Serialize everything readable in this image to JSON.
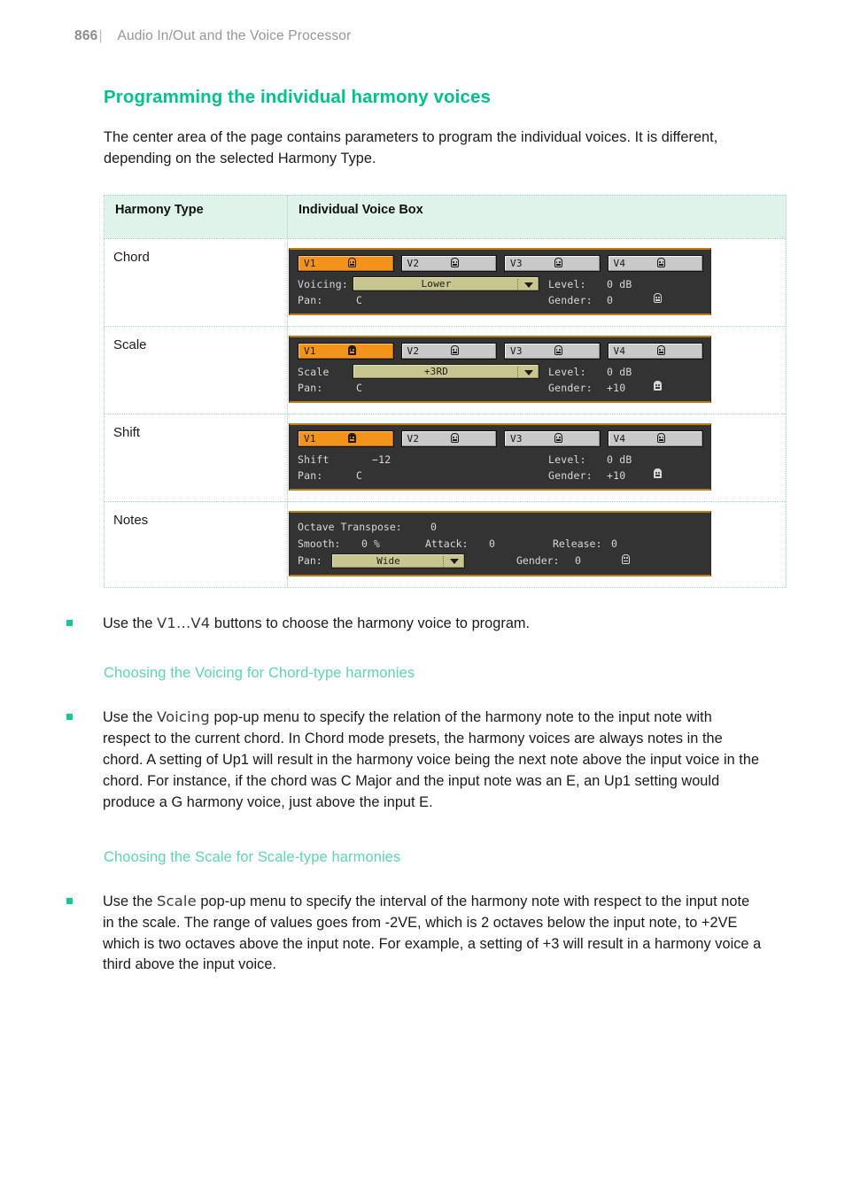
{
  "header": {
    "page_number": "866",
    "separator": "|",
    "chapter": "Audio In/Out and the Voice Processor"
  },
  "section": {
    "title": "Programming the individual harmony voices",
    "intro": "The center area of the page contains parameters to program the individual voices. It is different, depending on the selected Harmony Type."
  },
  "table": {
    "headers": {
      "type": "Harmony Type",
      "box": "Individual Voice Box"
    },
    "rows": [
      {
        "type": "Chord",
        "voice_buttons": [
          {
            "label": "V1",
            "icon": "head-icon",
            "active": true
          },
          {
            "label": "V2",
            "icon": "head-icon",
            "active": false
          },
          {
            "label": "V3",
            "icon": "head-icon",
            "active": false
          },
          {
            "label": "V4",
            "icon": "head-icon",
            "active": false
          }
        ],
        "param_label": "Voicing:",
        "param_control": "dropdown",
        "param_value": "Lower",
        "level_label": "Level:",
        "level_value": "0 dB",
        "pan_label": "Pan:",
        "pan_value": "C",
        "gender_label": "Gender:",
        "gender_value": "0",
        "gender_icon": "head-icon"
      },
      {
        "type": "Scale",
        "voice_buttons": [
          {
            "label": "V1",
            "icon": "head-filled-icon",
            "active": true
          },
          {
            "label": "V2",
            "icon": "head-icon",
            "active": false
          },
          {
            "label": "V3",
            "icon": "head-icon",
            "active": false
          },
          {
            "label": "V4",
            "icon": "head-icon",
            "active": false
          }
        ],
        "param_label": "Scale",
        "param_control": "dropdown",
        "param_value": "+3RD",
        "level_label": "Level:",
        "level_value": "0 dB",
        "pan_label": "Pan:",
        "pan_value": "C",
        "gender_label": "Gender:",
        "gender_value": "+10",
        "gender_icon": "head-filled-icon"
      },
      {
        "type": "Shift",
        "voice_buttons": [
          {
            "label": "V1",
            "icon": "head-filled-icon",
            "active": true
          },
          {
            "label": "V2",
            "icon": "head-icon",
            "active": false
          },
          {
            "label": "V3",
            "icon": "head-icon",
            "active": false
          },
          {
            "label": "V4",
            "icon": "head-icon",
            "active": false
          }
        ],
        "param_label": "Shift",
        "param_control": "value",
        "param_value": "−12",
        "level_label": "Level:",
        "level_value": "0 dB",
        "pan_label": "Pan:",
        "pan_value": "C",
        "gender_label": "Gender:",
        "gender_value": "+10",
        "gender_icon": "head-filled-icon"
      },
      {
        "type": "Notes",
        "octave_label": "Octave Transpose:",
        "octave_value": "0",
        "smooth_label": "Smooth:",
        "smooth_value": "0 %",
        "attack_label": "Attack:",
        "attack_value": "0",
        "release_label": "Release:",
        "release_value": "0",
        "pan_label": "Pan:",
        "pan_value": "Wide",
        "gender_label": "Gender:",
        "gender_value": "0",
        "gender_icon": "head-icon"
      }
    ]
  },
  "bullets": {
    "voices": {
      "pre": "Use the ",
      "mono": "V1…V4",
      "post": " buttons to choose the harmony voice to program."
    },
    "voicing": {
      "pre": "Use the ",
      "mono": "Voicing",
      "post": " pop-up menu to specify the relation of the harmony note to the input note with respect to the current chord. In Chord mode presets, the harmony voices are always notes in the chord. A setting of Up1 will result in the harmony voice being the next note above the input voice in the chord. For instance, if the chord was C Major and the input note was an E, an Up1 setting would produce a G harmony voice, just above the input E."
    },
    "scale": {
      "pre": "Use the ",
      "mono": "Scale",
      "post": " pop-up menu to specify the interval of the harmony note with respect to the input note in the scale. The range of values goes from -2VE, which is 2 octaves below the input note, to +2VE which is two octaves above the input note. For example, a setting of +3 will result in a harmony voice a third above the input voice."
    }
  },
  "subheadings": {
    "voicing": "Choosing the Voicing for Chord-type harmonies",
    "scale": "Choosing the Scale for Scale-type harmonies"
  },
  "colors": {
    "accent_green": "#00c08b",
    "subhead_green": "#5fd3b2",
    "bullet_green": "#16c79a",
    "table_header_bg": "#dff3ea",
    "table_border": "#9fd9c6",
    "panel_bg": "#333333",
    "panel_border": "#c07c19",
    "button_active": "#f2941b",
    "button_inactive": "#c9c9c9",
    "dropdown_bg": "#c8c68f"
  }
}
